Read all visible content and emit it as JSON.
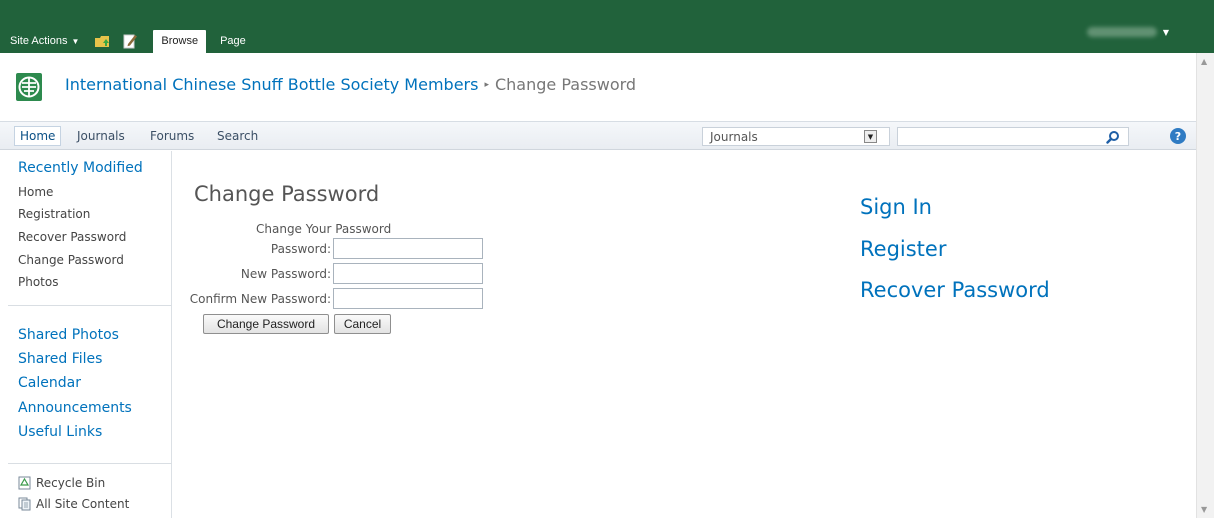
{
  "ribbon": {
    "site_actions": "Site Actions",
    "tabs": [
      {
        "label": "Browse"
      },
      {
        "label": "Page"
      }
    ],
    "colors": {
      "background": "#21623b"
    }
  },
  "breadcrumb": {
    "site": "International Chinese Snuff Bottle Society Members",
    "separator": "▸",
    "current": "Change Password"
  },
  "topnav": {
    "items": [
      {
        "label": "Home"
      },
      {
        "label": "Journals"
      },
      {
        "label": "Forums"
      },
      {
        "label": "Search"
      }
    ],
    "search_scope": "Journals",
    "search_value": ""
  },
  "leftnav": {
    "heading": "Recently Modified",
    "recent": [
      {
        "label": "Home"
      },
      {
        "label": "Registration"
      },
      {
        "label": "Recover Password"
      },
      {
        "label": "Change Password"
      },
      {
        "label": "Photos"
      }
    ],
    "links": [
      {
        "label": "Shared Photos"
      },
      {
        "label": "Shared Files"
      },
      {
        "label": "Calendar"
      },
      {
        "label": "Announcements"
      },
      {
        "label": "Useful Links"
      }
    ],
    "utilities": [
      {
        "label": "Recycle Bin",
        "icon": "recycle-bin-icon"
      },
      {
        "label": "All Site Content",
        "icon": "site-content-icon"
      }
    ]
  },
  "main": {
    "title": "Change Password",
    "form": {
      "caption": "Change Your Password",
      "password_label": "Password:",
      "new_password_label": "New Password:",
      "confirm_label": "Confirm New Password:",
      "submit_label": "Change Password",
      "cancel_label": "Cancel"
    }
  },
  "side_links": [
    {
      "label": "Sign In"
    },
    {
      "label": "Register"
    },
    {
      "label": "Recover Password"
    }
  ]
}
